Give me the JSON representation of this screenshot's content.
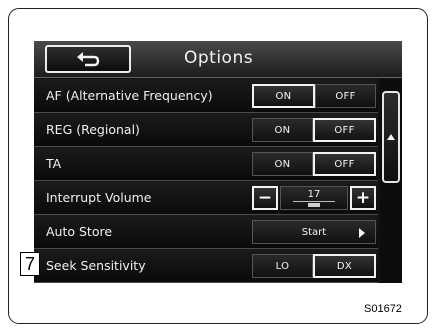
{
  "header": {
    "title": "Options",
    "back_icon": "return-arrow-icon"
  },
  "rows": [
    {
      "label": "AF (Alternative Frequency)",
      "control": "toggle",
      "options": [
        "ON",
        "OFF"
      ],
      "selected": "ON"
    },
    {
      "label": "REG (Regional)",
      "control": "toggle",
      "options": [
        "ON",
        "OFF"
      ],
      "selected": "OFF"
    },
    {
      "label": "TA",
      "control": "toggle",
      "options": [
        "ON",
        "OFF"
      ],
      "selected": "OFF"
    },
    {
      "label": "Interrupt Volume",
      "control": "stepper",
      "minus": "−",
      "value": "17",
      "plus": "+"
    },
    {
      "label": "Auto Store",
      "control": "button",
      "button_label": "Start"
    },
    {
      "label": "Seek Sensitivity",
      "control": "toggle",
      "options": [
        "LO",
        "DX"
      ],
      "selected": "DX"
    }
  ],
  "scrollbar": {
    "up_icon": "triangle-up-icon"
  },
  "callout": "7",
  "figure_code": "S01672"
}
